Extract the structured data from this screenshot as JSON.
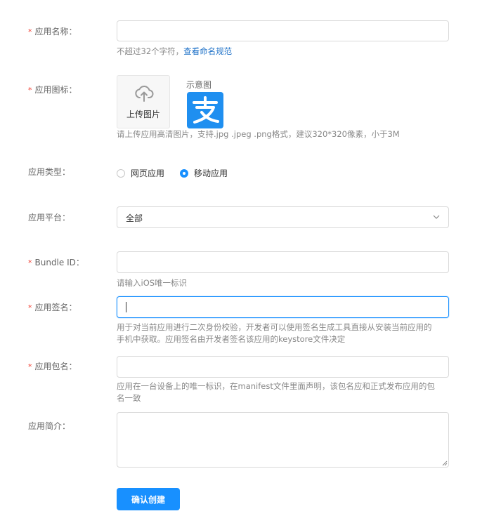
{
  "form": {
    "app_name": {
      "required_mark": "*",
      "label": "应用名称：",
      "value": "",
      "help_text": "不超过32个字符，",
      "help_link": "查看命名规范"
    },
    "app_icon": {
      "required_mark": "*",
      "label": "应用图标：",
      "upload_label": "上传图片",
      "sample_label": "示意图",
      "sample_glyph": "支",
      "help_text": "请上传应用高清图片，支持.jpg .jpeg .png格式，建议320*320像素，小于3M"
    },
    "app_type": {
      "label": "应用类型：",
      "options": [
        {
          "label": "网页应用",
          "selected": false
        },
        {
          "label": "移动应用",
          "selected": true
        }
      ]
    },
    "app_platform": {
      "label": "应用平台：",
      "selected": "全部"
    },
    "bundle_id": {
      "required_mark": "*",
      "label": "Bundle ID：",
      "value": "",
      "help_text": "请输入iOS唯一标识"
    },
    "app_signature": {
      "required_mark": "*",
      "label": "应用签名：",
      "value": "",
      "help_line1": "用于对当前应用进行二次身份校验，开发者可以使用签名生成工具直接从安装当前应用的",
      "help_line2": "手机中获取。应用签名由开发者签名该应用的keystore文件决定"
    },
    "package_name": {
      "required_mark": "*",
      "label": "应用包名：",
      "value": "",
      "help_line1": "应用在一台设备上的唯一标识，在manifest文件里面声明，该包名应和正式发布应用的包",
      "help_line2": "名一致"
    },
    "app_intro": {
      "label": "应用简介：",
      "value": ""
    },
    "submit_label": "确认创建"
  },
  "colors": {
    "accent": "#1890ff",
    "required": "#f04134",
    "link": "#1b6fc7",
    "sample_logo_bg": "#1f8ff0"
  },
  "icons": {
    "upload": "cloud-upload-icon",
    "select_arrow": "chevron-down-icon"
  }
}
